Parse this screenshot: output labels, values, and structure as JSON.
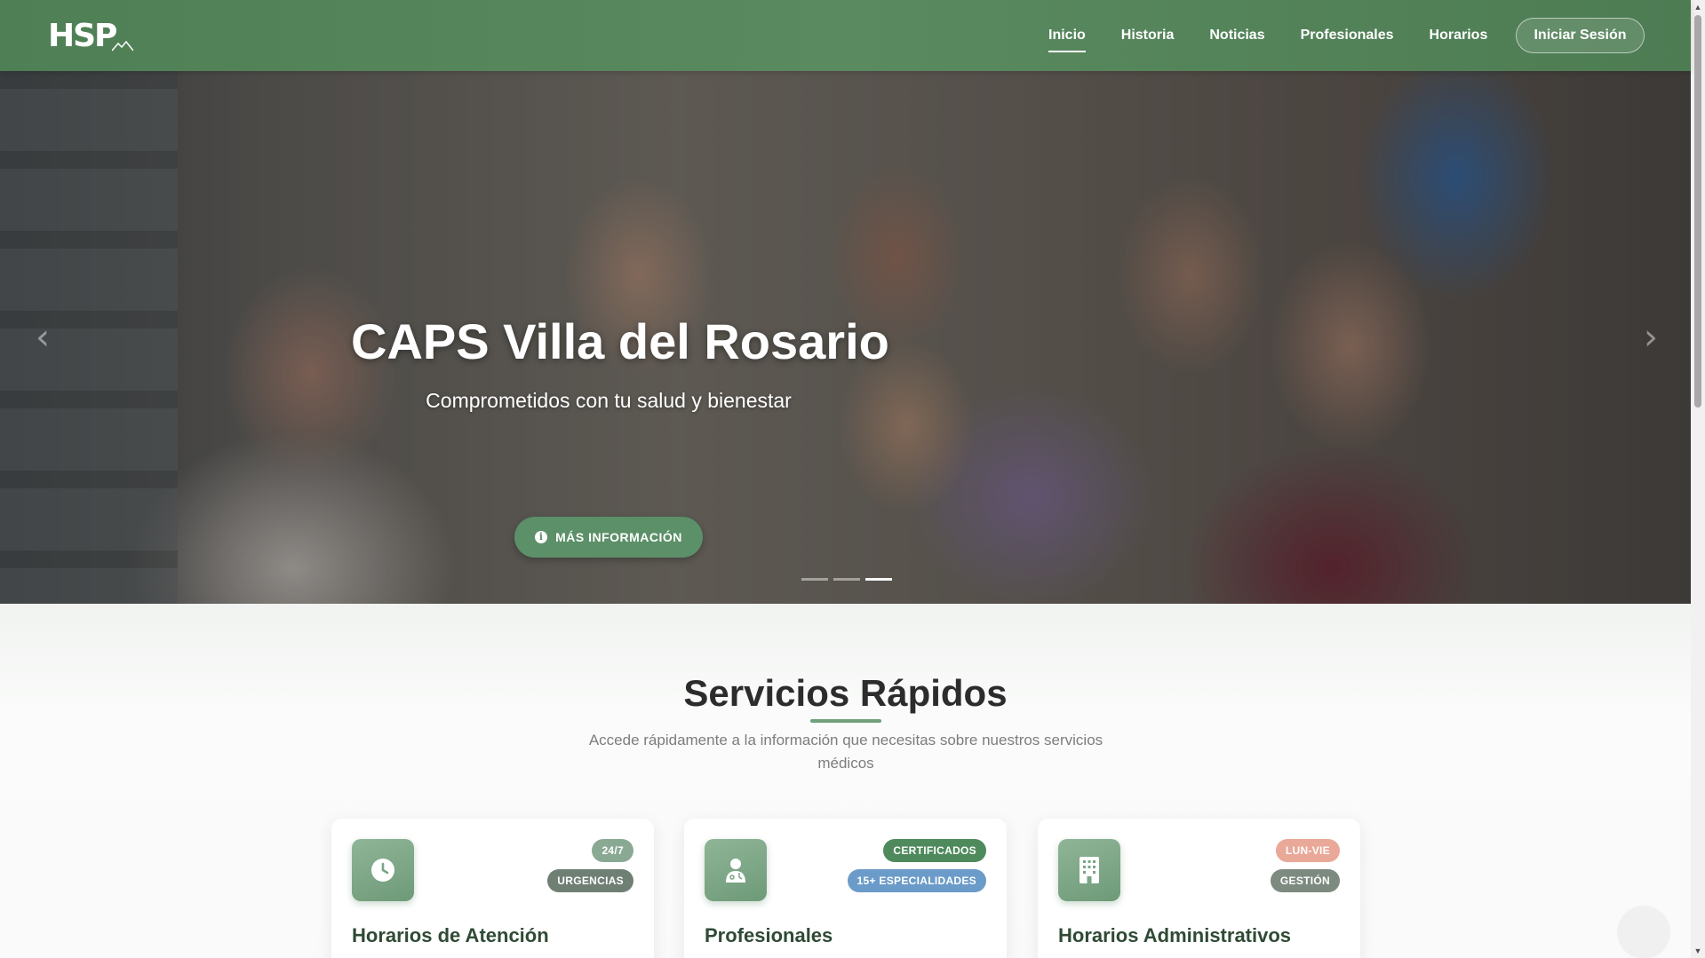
{
  "brand": {
    "logo_text": "HSP",
    "logo_icon": "mountain-icon"
  },
  "nav": {
    "items": [
      {
        "label": "Inicio",
        "active": true
      },
      {
        "label": "Historia",
        "active": false
      },
      {
        "label": "Noticias",
        "active": false
      },
      {
        "label": "Profesionales",
        "active": false
      },
      {
        "label": "Horarios",
        "active": false
      }
    ],
    "login_label": "Iniciar Sesión"
  },
  "hero": {
    "title": "CAPS Villa del Rosario",
    "subtitle": "Comprometidos con tu salud y bienestar",
    "button_label": "MÁS INFORMACIÓN",
    "button_icon": "info-icon",
    "prev_icon": "chevron-left-icon",
    "next_icon": "chevron-right-icon",
    "slide_count": 3,
    "active_slide": 3
  },
  "services": {
    "title": "Servicios Rápidos",
    "subtitle": "Accede rápidamente a la información que necesitas sobre nuestros servicios médicos",
    "cards": [
      {
        "title": "Horarios de Atención",
        "icon": "clock-icon",
        "badges": [
          {
            "label": "24/7",
            "color": "#8aa993"
          },
          {
            "label": "URGENCIAS",
            "color": "#6f7f74"
          }
        ]
      },
      {
        "title": "Profesionales",
        "icon": "doctor-icon",
        "badges": [
          {
            "label": "CERTIFICADOS",
            "color": "#4f8a5c"
          },
          {
            "label": "15+ ESPECIALIDADES",
            "color": "#6b9bc9"
          }
        ]
      },
      {
        "title": "Horarios Administrativos",
        "icon": "building-icon",
        "badges": [
          {
            "label": "LUN-VIE",
            "color": "#e9a898"
          },
          {
            "label": "GESTIÓN",
            "color": "#7d8a7f"
          }
        ]
      }
    ]
  },
  "colors": {
    "nav_green": "#5a8a60",
    "accent_green": "#5c9068",
    "card_title": "#2f4a35"
  }
}
